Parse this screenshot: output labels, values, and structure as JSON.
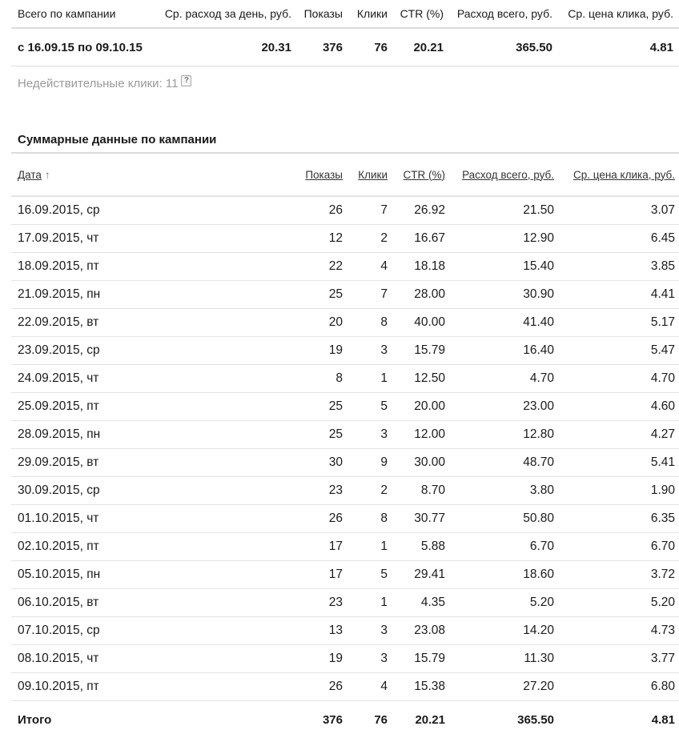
{
  "summary": {
    "headers": [
      "Всего по кампании",
      "Ср. расход за день, руб.",
      "Показы",
      "Клики",
      "CTR (%)",
      "Расход всего, руб.",
      "Ср. цена клика, руб."
    ],
    "values": [
      "с 16.09.15 по 09.10.15",
      "20.31",
      "376",
      "76",
      "20.21",
      "365.50",
      "4.81"
    ]
  },
  "invalid_clicks": "Недействительные клики: 11",
  "help_glyph": "?",
  "section_title": "Суммарные данные по кампании",
  "daily": {
    "headers": {
      "date": "Дата",
      "sort_arrow": "↑",
      "shows": "Показы",
      "clicks": "Клики",
      "ctr": "CTR (%)",
      "spend": "Расход всего, руб.",
      "cpc": "Ср. цена клика, руб."
    },
    "rows": [
      [
        "16.09.2015, ср",
        "26",
        "7",
        "26.92",
        "21.50",
        "3.07"
      ],
      [
        "17.09.2015, чт",
        "12",
        "2",
        "16.67",
        "12.90",
        "6.45"
      ],
      [
        "18.09.2015, пт",
        "22",
        "4",
        "18.18",
        "15.40",
        "3.85"
      ],
      [
        "21.09.2015, пн",
        "25",
        "7",
        "28.00",
        "30.90",
        "4.41"
      ],
      [
        "22.09.2015, вт",
        "20",
        "8",
        "40.00",
        "41.40",
        "5.17"
      ],
      [
        "23.09.2015, ср",
        "19",
        "3",
        "15.79",
        "16.40",
        "5.47"
      ],
      [
        "24.09.2015, чт",
        "8",
        "1",
        "12.50",
        "4.70",
        "4.70"
      ],
      [
        "25.09.2015, пт",
        "25",
        "5",
        "20.00",
        "23.00",
        "4.60"
      ],
      [
        "28.09.2015, пн",
        "25",
        "3",
        "12.00",
        "12.80",
        "4.27"
      ],
      [
        "29.09.2015, вт",
        "30",
        "9",
        "30.00",
        "48.70",
        "5.41"
      ],
      [
        "30.09.2015, ср",
        "23",
        "2",
        "8.70",
        "3.80",
        "1.90"
      ],
      [
        "01.10.2015, чт",
        "26",
        "8",
        "30.77",
        "50.80",
        "6.35"
      ],
      [
        "02.10.2015, пт",
        "17",
        "1",
        "5.88",
        "6.70",
        "6.70"
      ],
      [
        "05.10.2015, пн",
        "17",
        "5",
        "29.41",
        "18.60",
        "3.72"
      ],
      [
        "06.10.2015, вт",
        "23",
        "1",
        "4.35",
        "5.20",
        "5.20"
      ],
      [
        "07.10.2015, ср",
        "13",
        "3",
        "23.08",
        "14.20",
        "4.73"
      ],
      [
        "08.10.2015, чт",
        "19",
        "3",
        "15.79",
        "11.30",
        "3.77"
      ],
      [
        "09.10.2015, пт",
        "26",
        "4",
        "15.38",
        "27.20",
        "6.80"
      ]
    ],
    "total": [
      "Итого",
      "376",
      "76",
      "20.21",
      "365.50",
      "4.81"
    ]
  }
}
